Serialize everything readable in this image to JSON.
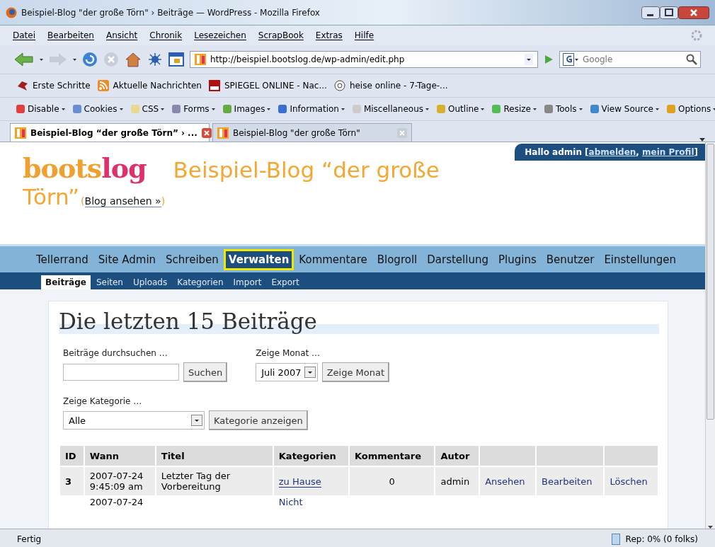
{
  "window": {
    "title": "Beispiel-Blog \"der große Törn\" › Beiträge — WordPress - Mozilla Firefox"
  },
  "menu": [
    "Datei",
    "Bearbeiten",
    "Ansicht",
    "Chronik",
    "Lesezeichen",
    "ScrapBook",
    "Extras",
    "Hilfe"
  ],
  "address_bar": {
    "url": "http://beispiel.bootslog.de/wp-admin/edit.php"
  },
  "search_bar": {
    "placeholder": "Google"
  },
  "bookmarks": [
    "Erste Schritte",
    "Aktuelle Nachrichten",
    "SPIEGEL ONLINE - Nac...",
    "heise online - 7-Tage-..."
  ],
  "developer_toolbar": [
    "Disable",
    "Cookies",
    "CSS",
    "Forms",
    "Images",
    "Information",
    "Miscellaneous",
    "Outline",
    "Resize",
    "Tools",
    "View Source",
    "Options"
  ],
  "tabs": [
    {
      "label": "Beispiel-Blog “der große Törn” › ...",
      "selected": true
    },
    {
      "label": "Beispiel-Blog \"der große Törn\"",
      "selected": false
    }
  ],
  "page": {
    "user_bar": {
      "greeting": "Hallo admin [",
      "logout": "abmelden",
      "separator": ",",
      "profile": "mein Profil",
      "closing": "]"
    },
    "logo": {
      "first": "boots",
      "second": "log"
    },
    "blog_title": "Beispiel-Blog “der große Törn”",
    "view_blog": {
      "open": "(",
      "link": "Blog ansehen »",
      "close": ")"
    },
    "nav": [
      {
        "label": "Tellerrand",
        "selected": false
      },
      {
        "label": "Site Admin",
        "selected": false
      },
      {
        "label": "Schreiben",
        "selected": false
      },
      {
        "label": "Verwalten",
        "selected": true
      },
      {
        "label": "Kommentare",
        "selected": false
      },
      {
        "label": "Blogroll",
        "selected": false
      },
      {
        "label": "Darstellung",
        "selected": false
      },
      {
        "label": "Plugins",
        "selected": false
      },
      {
        "label": "Benutzer",
        "selected": false
      },
      {
        "label": "Einstellungen",
        "selected": false
      }
    ],
    "subnav": [
      {
        "label": "Beiträge",
        "selected": true
      },
      {
        "label": "Seiten",
        "selected": false
      },
      {
        "label": "Uploads",
        "selected": false
      },
      {
        "label": "Kategorien",
        "selected": false
      },
      {
        "label": "Import",
        "selected": false
      },
      {
        "label": "Export",
        "selected": false
      }
    ],
    "heading": "Die letzten 15 Beiträge",
    "search": {
      "label": "Beiträge durchsuchen …",
      "button": "Suchen"
    },
    "month": {
      "label": "Zeige Monat …",
      "value": "Juli 2007",
      "button": "Zeige Monat"
    },
    "category": {
      "label": "Zeige Kategorie …",
      "value": "Alle",
      "button": "Kategorie anzeigen"
    },
    "table": {
      "columns": [
        "ID",
        "Wann",
        "Titel",
        "Kategorien",
        "Kommentare",
        "Autor"
      ],
      "rows": [
        {
          "id": "3",
          "date": "2007-07-24",
          "time": "9:45:09 am",
          "title": "Letzter Tag der Vorbereitung",
          "category": "zu Hause",
          "comments": "0",
          "author": "admin",
          "actions": [
            "Ansehen",
            "Bearbeiten",
            "Löschen"
          ]
        },
        {
          "date": "2007-07-24",
          "category": "Nicht"
        }
      ]
    }
  },
  "status_bar": {
    "text": "Fertig",
    "rep": "Rep: 0% (0 folks)"
  }
}
